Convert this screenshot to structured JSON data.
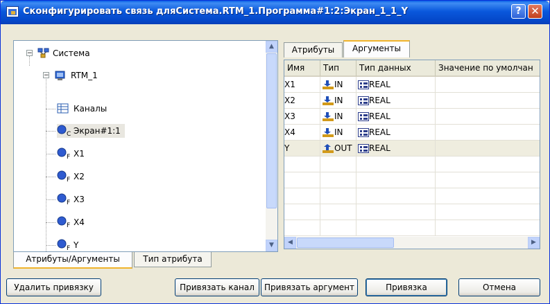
{
  "window": {
    "title": "Сконфигурировать связь дляСистема.RTM_1.Программа#1:2:Экран_1_1_Y",
    "help_label": "?",
    "close_label": "✕",
    "app_icon": "link-config-icon"
  },
  "tree": {
    "items": [
      {
        "label": "Система",
        "icon": "system-icon",
        "expander": "−"
      },
      {
        "label": "RTM_1",
        "icon": "rtm-node-icon",
        "expander": "−"
      },
      {
        "label": "Каналы",
        "icon": "channels-icon"
      },
      {
        "label": "Экран#1:1",
        "icon": "screen-component-icon",
        "sub": "C"
      },
      {
        "label": "X1",
        "icon": "function-input-icon",
        "sub": "F"
      },
      {
        "label": "X2",
        "icon": "function-input-icon",
        "sub": "F"
      },
      {
        "label": "X3",
        "icon": "function-input-icon",
        "sub": "F"
      },
      {
        "label": "X4",
        "icon": "function-input-icon",
        "sub": "F"
      },
      {
        "label": "Y",
        "icon": "function-input-icon",
        "sub": "F"
      }
    ],
    "scroll_up": "▲",
    "scroll_down": "▼"
  },
  "left_tabs": [
    {
      "label": "Атрибуты/Аргументы",
      "active": true
    },
    {
      "label": "Тип атрибута",
      "active": false
    }
  ],
  "right_tabs": [
    {
      "label": "Атрибуты",
      "active": false
    },
    {
      "label": "Аргументы",
      "active": true
    }
  ],
  "grid": {
    "columns": [
      "Имя",
      "Тип",
      "Тип данных",
      "Значение по умолчан"
    ],
    "rows": [
      {
        "name": "X1",
        "dir": "IN",
        "dtype": "REAL"
      },
      {
        "name": "X2",
        "dir": "IN",
        "dtype": "REAL"
      },
      {
        "name": "X3",
        "dir": "IN",
        "dtype": "REAL"
      },
      {
        "name": "X4",
        "dir": "IN",
        "dtype": "REAL"
      },
      {
        "name": "Y",
        "dir": "OUT",
        "dtype": "REAL"
      }
    ],
    "scroll_left": "◀",
    "scroll_right": "▶",
    "colors": {
      "in_arrow": "#d29a1a",
      "out_arrow": "#d29a1a",
      "type_icon": "#2b3c8a"
    }
  },
  "buttons": {
    "unbind": "Удалить привязку",
    "bind_channel": "Привязать канал",
    "bind_argument": "Привязать аргумент",
    "binding": "Привязка",
    "cancel": "Отмена"
  }
}
